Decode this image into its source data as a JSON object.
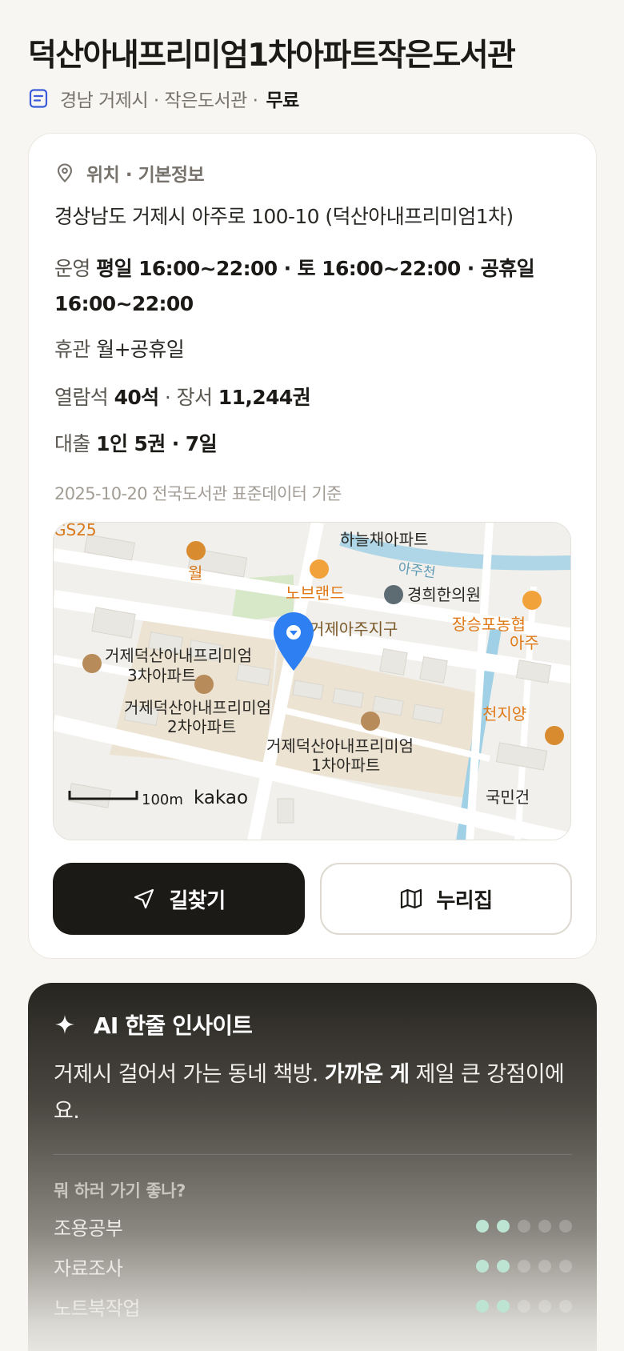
{
  "header": {
    "title": "덕산아내프리미엄1차아파트작은도서관",
    "meta": "경남 거제시 · 작은도서관 ·",
    "fee": "무료"
  },
  "info": {
    "section_title": "위치 · 기본정보",
    "address": "경상남도 거제시 아주로 100-10 (덕산아내프리미엄1차)",
    "hours_label": "운영",
    "hours_value": "평일 16:00~22:00 · 토 16:00~22:00 · 공휴일 16:00~22:00",
    "closed_label": "휴관",
    "closed_value": "월+공휴일",
    "seats_label": "열람석",
    "seats_value": "40석",
    "books_label": "· 장서",
    "books_value": "11,244권",
    "loan_label": "대출",
    "loan_value": "1인 5권 · 7일",
    "source": "2025-10-20 전국도서관 표준데이터 기준"
  },
  "map": {
    "labels": {
      "gs25": "GS25",
      "hanul": "하늘채아파트",
      "ajucheon": "아주천",
      "wol": "월",
      "nobrand": "노브랜드",
      "clinic": "경희한의원",
      "jangseung": "장승포농협",
      "aju_partial": "아주",
      "district": "거제아주지구",
      "apt3_a": "거제덕산아내프리미엄",
      "apt3_b": "3차아파트",
      "apt2_a": "거제덕산아내프리미엄",
      "apt2_b": "2차아파트",
      "apt1_a": "거제덕산아내프리미엄",
      "apt1_b": "1차아파트",
      "cheonji": "천지양",
      "gukmin": "국민건",
      "scale": "100m",
      "brand": "kakao"
    }
  },
  "actions": {
    "route_label": "길찾기",
    "site_label": "누리집"
  },
  "ai": {
    "title": "AI 한줄 인사이트",
    "text_before": "거제시 걸어서 가는 동네 책방. ",
    "text_bold": "가까운 게",
    "text_after": " 제일 큰 강점이에요.",
    "question": "뭐 하러 가기 좋나?",
    "activities": [
      {
        "label": "조용공부",
        "score": 2
      },
      {
        "label": "자료조사",
        "score": 2
      },
      {
        "label": "노트북작업",
        "score": 2
      }
    ],
    "max_score": 5
  },
  "colors": {
    "accent_dark": "#1c1a17",
    "map_pin": "#2d7ff2",
    "poi_orange": "#d87a1c",
    "dot_on": "#bde3d3"
  }
}
